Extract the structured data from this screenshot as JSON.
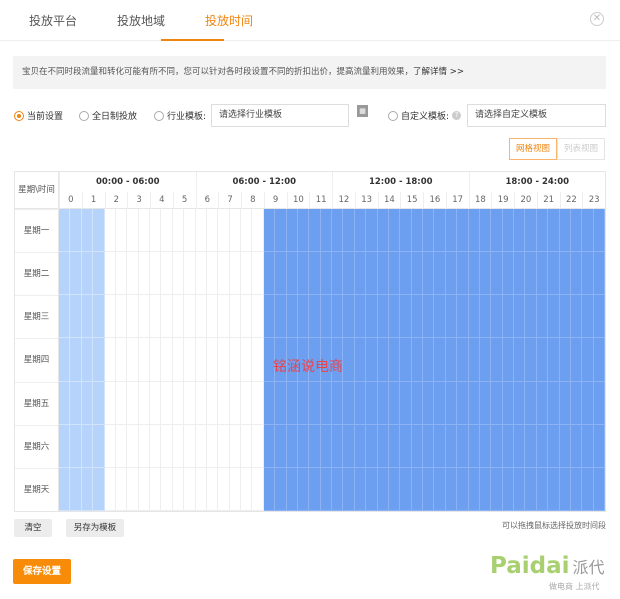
{
  "tabs": [
    {
      "label": "投放平台"
    },
    {
      "label": "投放地域"
    },
    {
      "label": "投放时间"
    }
  ],
  "notice": {
    "text": "宝贝在不同时段流量和转化可能有所不同，您可以针对各时段设置不同的折扣出价，提高流量利用效果，",
    "link": "了解详情 >>"
  },
  "options": {
    "current": "当前设置",
    "all_day": "全日制投放",
    "industry": "行业模板:",
    "industry_placeholder": "请选择行业模板",
    "custom": "自定义模板:",
    "custom_placeholder": "请选择自定义模板",
    "help": "?"
  },
  "views": {
    "grid": "网格视图",
    "list": "列表视图"
  },
  "grid": {
    "corner": "星期\\时间",
    "segments": [
      "00:00 - 06:00",
      "06:00 - 12:00",
      "12:00 - 18:00",
      "18:00 - 24:00"
    ],
    "hours": [
      "0",
      "1",
      "2",
      "3",
      "4",
      "5",
      "6",
      "7",
      "8",
      "9",
      "10",
      "11",
      "12",
      "13",
      "14",
      "15",
      "16",
      "17",
      "18",
      "19",
      "20",
      "21",
      "22",
      "23"
    ],
    "days": [
      "星期一",
      "星期二",
      "星期三",
      "星期四",
      "星期五",
      "星期六",
      "星期天"
    ],
    "hour_state": [
      "light",
      "light",
      "none",
      "none",
      "none",
      "none",
      "none",
      "none",
      "none",
      "full",
      "full",
      "full",
      "full",
      "full",
      "full",
      "full",
      "full",
      "full",
      "full",
      "full",
      "full",
      "full",
      "full",
      "full"
    ]
  },
  "watermark": "铭涵说电商",
  "actions": {
    "clear": "清空",
    "save_template": "另存为模板",
    "hint": "可以拖拽鼠标选择投放时间段",
    "save": "保存设置"
  },
  "logo": {
    "text": "Paidai",
    "cn": "派代",
    "slogan": "做电商 上派代"
  },
  "colors": {
    "accent": "#f0850f",
    "full": "#6d9ff0",
    "light": "#b6d3fb"
  }
}
